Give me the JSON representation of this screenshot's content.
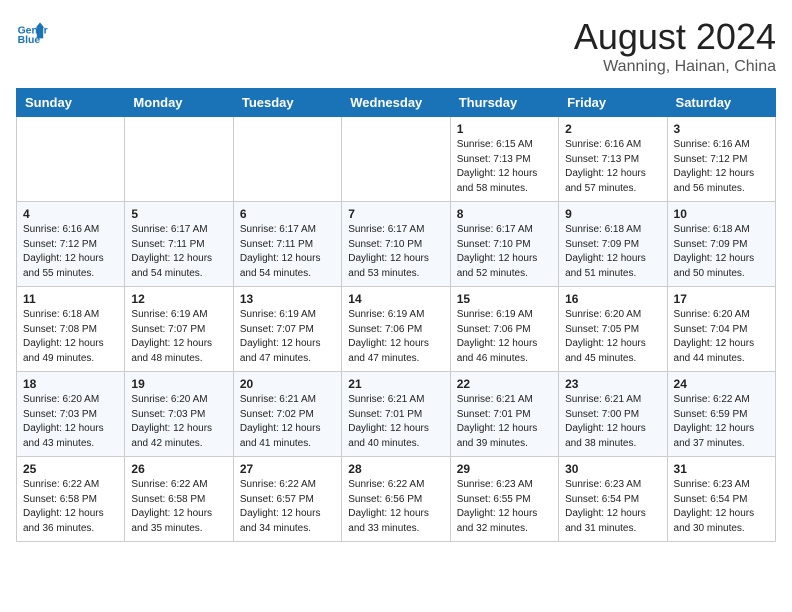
{
  "logo": {
    "line1": "General",
    "line2": "Blue"
  },
  "title": "August 2024",
  "location": "Wanning, Hainan, China",
  "days_of_week": [
    "Sunday",
    "Monday",
    "Tuesday",
    "Wednesday",
    "Thursday",
    "Friday",
    "Saturday"
  ],
  "weeks": [
    [
      {
        "day": "",
        "info": ""
      },
      {
        "day": "",
        "info": ""
      },
      {
        "day": "",
        "info": ""
      },
      {
        "day": "",
        "info": ""
      },
      {
        "day": "1",
        "sunrise": "6:15 AM",
        "sunset": "7:13 PM",
        "daylight": "12 hours and 58 minutes."
      },
      {
        "day": "2",
        "sunrise": "6:16 AM",
        "sunset": "7:13 PM",
        "daylight": "12 hours and 57 minutes."
      },
      {
        "day": "3",
        "sunrise": "6:16 AM",
        "sunset": "7:12 PM",
        "daylight": "12 hours and 56 minutes."
      }
    ],
    [
      {
        "day": "4",
        "sunrise": "6:16 AM",
        "sunset": "7:12 PM",
        "daylight": "12 hours and 55 minutes."
      },
      {
        "day": "5",
        "sunrise": "6:17 AM",
        "sunset": "7:11 PM",
        "daylight": "12 hours and 54 minutes."
      },
      {
        "day": "6",
        "sunrise": "6:17 AM",
        "sunset": "7:11 PM",
        "daylight": "12 hours and 54 minutes."
      },
      {
        "day": "7",
        "sunrise": "6:17 AM",
        "sunset": "7:10 PM",
        "daylight": "12 hours and 53 minutes."
      },
      {
        "day": "8",
        "sunrise": "6:17 AM",
        "sunset": "7:10 PM",
        "daylight": "12 hours and 52 minutes."
      },
      {
        "day": "9",
        "sunrise": "6:18 AM",
        "sunset": "7:09 PM",
        "daylight": "12 hours and 51 minutes."
      },
      {
        "day": "10",
        "sunrise": "6:18 AM",
        "sunset": "7:09 PM",
        "daylight": "12 hours and 50 minutes."
      }
    ],
    [
      {
        "day": "11",
        "sunrise": "6:18 AM",
        "sunset": "7:08 PM",
        "daylight": "12 hours and 49 minutes."
      },
      {
        "day": "12",
        "sunrise": "6:19 AM",
        "sunset": "7:07 PM",
        "daylight": "12 hours and 48 minutes."
      },
      {
        "day": "13",
        "sunrise": "6:19 AM",
        "sunset": "7:07 PM",
        "daylight": "12 hours and 47 minutes."
      },
      {
        "day": "14",
        "sunrise": "6:19 AM",
        "sunset": "7:06 PM",
        "daylight": "12 hours and 47 minutes."
      },
      {
        "day": "15",
        "sunrise": "6:19 AM",
        "sunset": "7:06 PM",
        "daylight": "12 hours and 46 minutes."
      },
      {
        "day": "16",
        "sunrise": "6:20 AM",
        "sunset": "7:05 PM",
        "daylight": "12 hours and 45 minutes."
      },
      {
        "day": "17",
        "sunrise": "6:20 AM",
        "sunset": "7:04 PM",
        "daylight": "12 hours and 44 minutes."
      }
    ],
    [
      {
        "day": "18",
        "sunrise": "6:20 AM",
        "sunset": "7:03 PM",
        "daylight": "12 hours and 43 minutes."
      },
      {
        "day": "19",
        "sunrise": "6:20 AM",
        "sunset": "7:03 PM",
        "daylight": "12 hours and 42 minutes."
      },
      {
        "day": "20",
        "sunrise": "6:21 AM",
        "sunset": "7:02 PM",
        "daylight": "12 hours and 41 minutes."
      },
      {
        "day": "21",
        "sunrise": "6:21 AM",
        "sunset": "7:01 PM",
        "daylight": "12 hours and 40 minutes."
      },
      {
        "day": "22",
        "sunrise": "6:21 AM",
        "sunset": "7:01 PM",
        "daylight": "12 hours and 39 minutes."
      },
      {
        "day": "23",
        "sunrise": "6:21 AM",
        "sunset": "7:00 PM",
        "daylight": "12 hours and 38 minutes."
      },
      {
        "day": "24",
        "sunrise": "6:22 AM",
        "sunset": "6:59 PM",
        "daylight": "12 hours and 37 minutes."
      }
    ],
    [
      {
        "day": "25",
        "sunrise": "6:22 AM",
        "sunset": "6:58 PM",
        "daylight": "12 hours and 36 minutes."
      },
      {
        "day": "26",
        "sunrise": "6:22 AM",
        "sunset": "6:58 PM",
        "daylight": "12 hours and 35 minutes."
      },
      {
        "day": "27",
        "sunrise": "6:22 AM",
        "sunset": "6:57 PM",
        "daylight": "12 hours and 34 minutes."
      },
      {
        "day": "28",
        "sunrise": "6:22 AM",
        "sunset": "6:56 PM",
        "daylight": "12 hours and 33 minutes."
      },
      {
        "day": "29",
        "sunrise": "6:23 AM",
        "sunset": "6:55 PM",
        "daylight": "12 hours and 32 minutes."
      },
      {
        "day": "30",
        "sunrise": "6:23 AM",
        "sunset": "6:54 PM",
        "daylight": "12 hours and 31 minutes."
      },
      {
        "day": "31",
        "sunrise": "6:23 AM",
        "sunset": "6:54 PM",
        "daylight": "12 hours and 30 minutes."
      }
    ]
  ],
  "labels": {
    "sunrise": "Sunrise:",
    "sunset": "Sunset:",
    "daylight": "Daylight:"
  }
}
